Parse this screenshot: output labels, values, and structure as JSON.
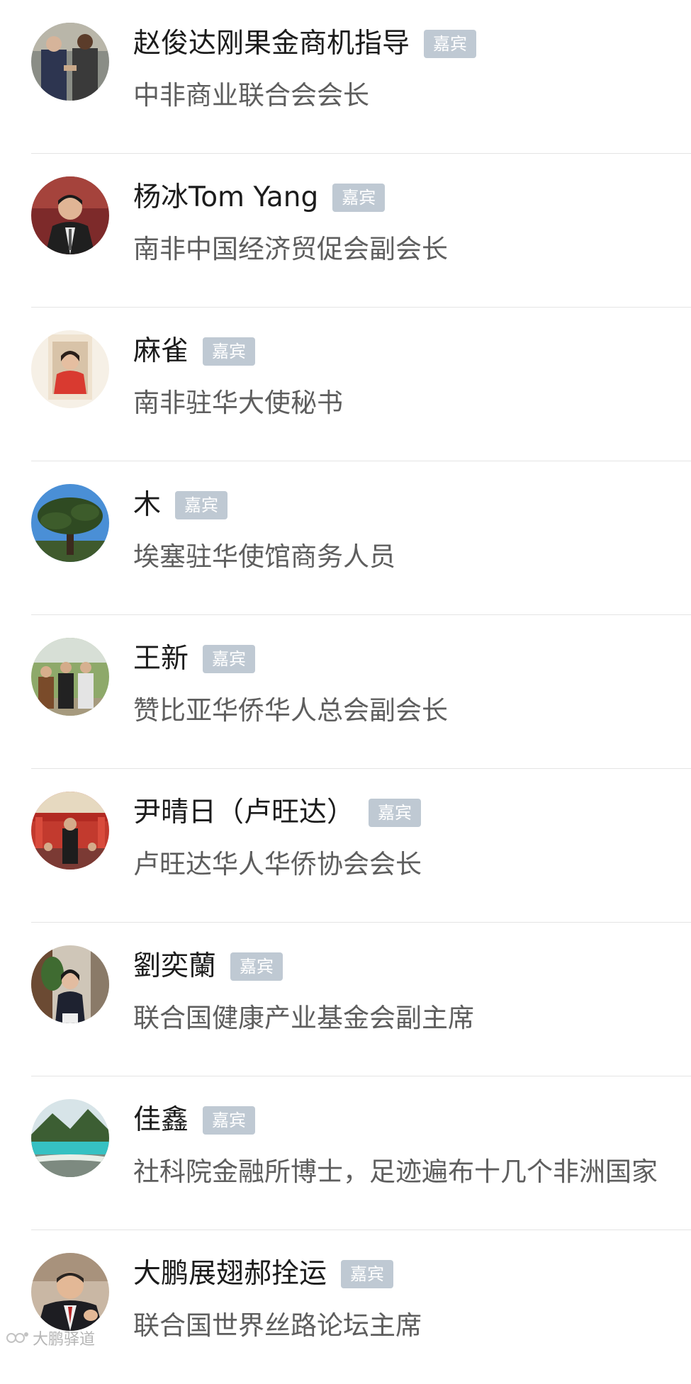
{
  "guests": [
    {
      "name": "赵俊达刚果金商机指导",
      "badge": "嘉宾",
      "title": "中非商业联合会会长"
    },
    {
      "name": "杨冰Tom Yang",
      "badge": "嘉宾",
      "title": "南非中国经济贸促会副会长"
    },
    {
      "name": "麻雀",
      "badge": "嘉宾",
      "title": "南非驻华大使秘书"
    },
    {
      "name": "木",
      "badge": "嘉宾",
      "title": "埃塞驻华使馆商务人员"
    },
    {
      "name": "王新",
      "badge": "嘉宾",
      "title": "赞比亚华侨华人总会副会长"
    },
    {
      "name": "尹晴日（卢旺达）",
      "badge": "嘉宾",
      "title": "卢旺达华人华侨协会会长"
    },
    {
      "name": "劉奕蘭",
      "badge": "嘉宾",
      "title": "联合国健康产业基金会副主席"
    },
    {
      "name": "佳鑫",
      "badge": "嘉宾",
      "title": "社科院金融所博士，足迹遍布十几个非洲国家"
    },
    {
      "name": "大鹏展翅郝拴运",
      "badge": "嘉宾",
      "title": "联合国世界丝路论坛主席"
    }
  ],
  "avatar_icons": [
    "handshake-photo-avatar-icon",
    "portrait-photo-avatar-icon",
    "portrait-photo-avatar-icon",
    "tree-photo-avatar-icon",
    "group-photo-avatar-icon",
    "conference-photo-avatar-icon",
    "portrait-photo-avatar-icon",
    "landscape-photo-avatar-icon",
    "portrait-photo-avatar-icon"
  ],
  "watermark": {
    "text": "大鹏驿道"
  },
  "colors": {
    "badge_bg": "#bfc9d3",
    "badge_text": "#ffffff",
    "name_text": "#1c1c1c",
    "title_text": "#5e5e5e",
    "divider": "#e4e4e4"
  }
}
